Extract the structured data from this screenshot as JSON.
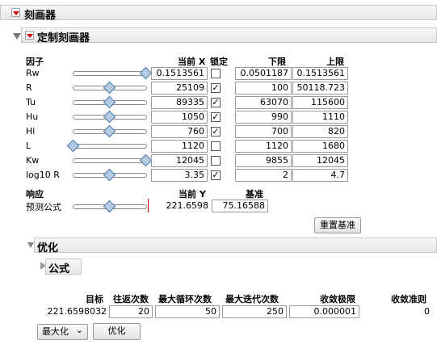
{
  "profiler": {
    "title": "刻画器"
  },
  "custom_profiler": {
    "title": "定制刻画器"
  },
  "factors_table": {
    "headers": {
      "factor": "因子",
      "current_x": "当前 X",
      "lock": "锁定",
      "lower": "下限",
      "upper": "上限"
    },
    "rows": [
      {
        "name": "Rw",
        "current": "0.1513561",
        "locked": false,
        "lower": "0.0501187",
        "upper": "0.1513561",
        "slider": 1.0
      },
      {
        "name": "R",
        "current": "25109",
        "locked": true,
        "lower": "100",
        "upper": "50118.723",
        "slider": 0.5
      },
      {
        "name": "Tu",
        "current": "89335",
        "locked": true,
        "lower": "63070",
        "upper": "115600",
        "slider": 0.5
      },
      {
        "name": "Hu",
        "current": "1050",
        "locked": true,
        "lower": "990",
        "upper": "1110",
        "slider": 0.5
      },
      {
        "name": "Hl",
        "current": "760",
        "locked": true,
        "lower": "700",
        "upper": "820",
        "slider": 0.5
      },
      {
        "name": "L",
        "current": "1120",
        "locked": false,
        "lower": "1120",
        "upper": "1680",
        "slider": 0.0
      },
      {
        "name": "Kw",
        "current": "12045",
        "locked": false,
        "lower": "9855",
        "upper": "12045",
        "slider": 1.0
      },
      {
        "name": "log10 R",
        "current": "3.35",
        "locked": true,
        "lower": "2",
        "upper": "4.7",
        "slider": 0.5
      }
    ]
  },
  "response": {
    "header": "响应",
    "current_y_header": "当前 Y",
    "baseline_header": "基准",
    "name": "预测公式",
    "current_y": "221.6598",
    "baseline": "75.16588",
    "slider": 0.5,
    "reset_button": "重置基准"
  },
  "optimize": {
    "title": "优化",
    "formula_title": "公式",
    "headers": {
      "target": "目标",
      "return_count": "往返次数",
      "max_loops": "最大循环次数",
      "max_iterations": "最大迭代次数",
      "convergence_limit": "收敛极限",
      "convergence_criterion": "收敛准则"
    },
    "values": {
      "target": "221.6598032",
      "return_count": "20",
      "max_loops": "50",
      "max_iterations": "250",
      "convergence_limit": "0.000001",
      "convergence_criterion": "0"
    },
    "mode_select": "最大化",
    "optimize_button": "优化"
  },
  "icons": {
    "check": "✓",
    "dropdown": "⌄"
  }
}
